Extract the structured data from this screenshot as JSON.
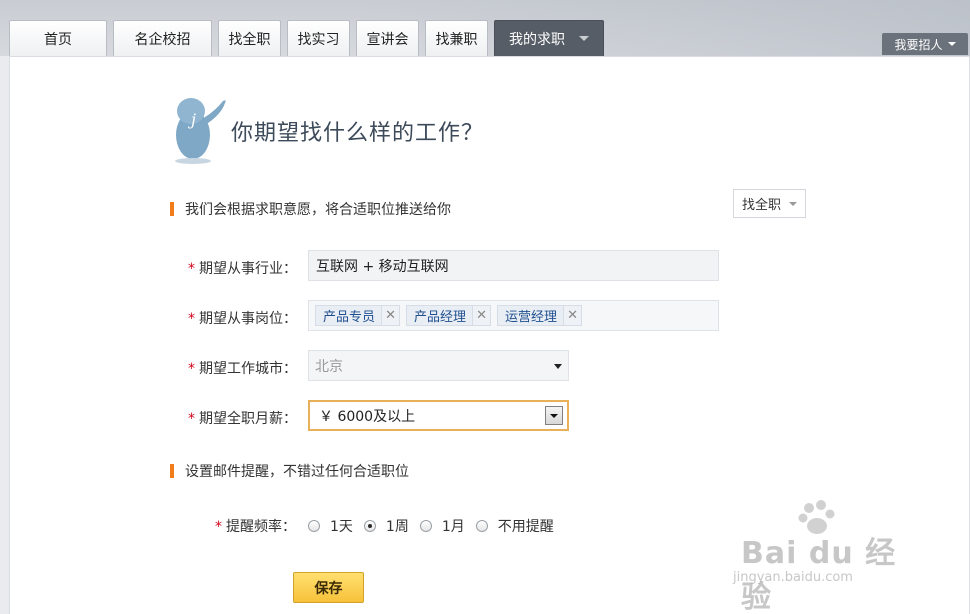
{
  "nav": {
    "tabs": [
      {
        "label": "首页"
      },
      {
        "label": "名企校招"
      },
      {
        "label": "找全职"
      },
      {
        "label": "找实习"
      },
      {
        "label": "宣讲会"
      },
      {
        "label": "找兼职"
      },
      {
        "label": "我的求职"
      }
    ],
    "hire_label": "我要招人"
  },
  "main": {
    "headline": "你期望找什么样的工作？",
    "section1": "我们会根据求职意愿，将合适职位推送给你",
    "job_type_select": "找全职",
    "industry": {
      "label": "期望从事行业：",
      "value": "互联网 + 移动互联网"
    },
    "position": {
      "label": "期望从事岗位：",
      "tags": [
        "产品专员",
        "产品经理",
        "运营经理"
      ],
      "remove_glyph": "✕"
    },
    "city": {
      "label": "期望工作城市：",
      "value": "北京"
    },
    "salary": {
      "label": "期望全职月薪：",
      "value": "￥ 6000及以上"
    },
    "required_mark": "*",
    "section2": "设置邮件提醒，不错过任何合适职位",
    "reminder": {
      "label": "提醒频率：",
      "options": [
        "1天",
        "1周",
        "1月",
        "不用提醒"
      ],
      "selected": "1周"
    },
    "save_label": "保存"
  },
  "watermark": {
    "brand": "Bai du 经验",
    "url": "jingyan.baidu.com"
  },
  "colors": {
    "accent_orange": "#f07d1a",
    "active_tab": "#565d66",
    "save_button": "#f7c13a",
    "required_star": "#d0021b"
  }
}
